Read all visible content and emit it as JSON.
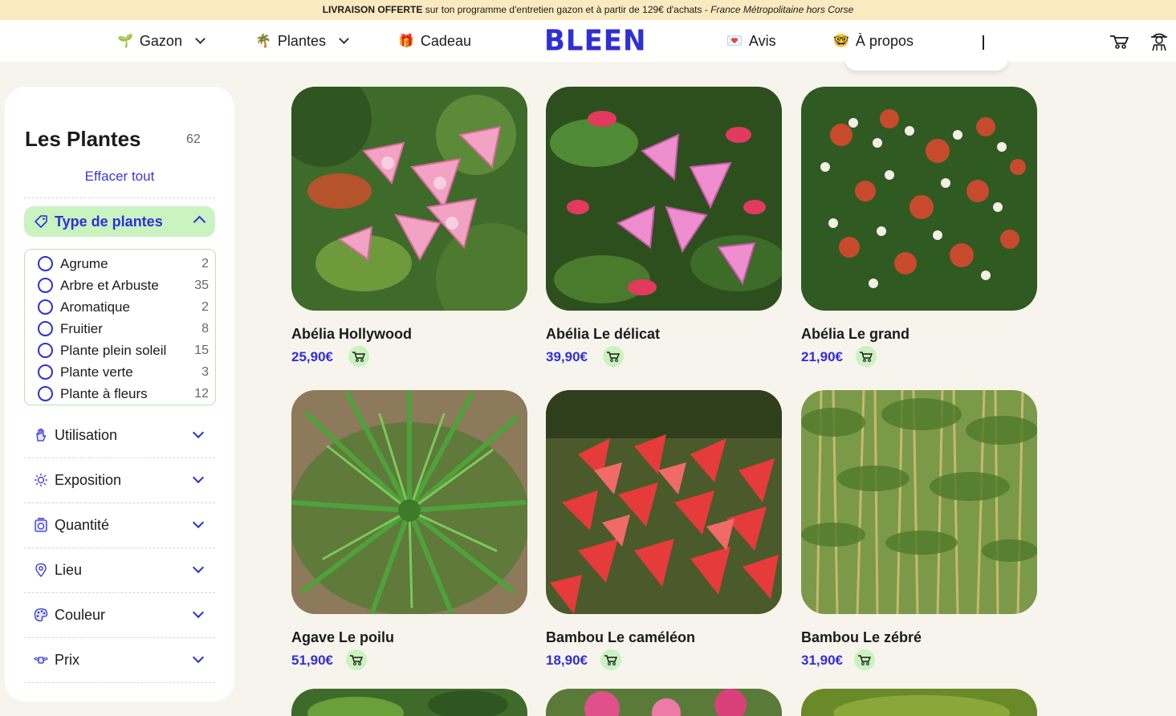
{
  "banner": {
    "bold": "LIVRAISON OFFERTE",
    "text": " sur ton programme d'entretien gazon et à partir de 129€ d'achats - ",
    "italic": "France Métropolitaine hors Corse"
  },
  "nav": {
    "items": [
      {
        "label": "Gazon",
        "emoji": "🌱"
      },
      {
        "label": "Plantes",
        "emoji": "🌴"
      },
      {
        "label": "Cadeau",
        "emoji": "🎁"
      },
      {
        "label": "Avis",
        "emoji": "💌"
      },
      {
        "label": "À propos",
        "emoji": "🤓"
      }
    ],
    "logo": "BLEEN",
    "icons": [
      "wheelbarrow-cart-icon",
      "user-gardener-icon"
    ]
  },
  "sidebar": {
    "title": "Les Plantes",
    "count": "62",
    "clear": "Effacer tout",
    "type_filter": {
      "label": "Type de plantes",
      "options": [
        {
          "label": "Agrume",
          "count": "2"
        },
        {
          "label": "Arbre et Arbuste",
          "count": "35"
        },
        {
          "label": "Aromatique",
          "count": "2"
        },
        {
          "label": "Fruitier",
          "count": "8"
        },
        {
          "label": "Plante plein soleil",
          "count": "15"
        },
        {
          "label": "Plante verte",
          "count": "3"
        },
        {
          "label": "Plante à fleurs",
          "count": "12"
        }
      ]
    },
    "facets": [
      {
        "label": "Utilisation",
        "icon": "hand-icon"
      },
      {
        "label": "Exposition",
        "icon": "sun-icon"
      },
      {
        "label": "Quantité",
        "icon": "scale-icon"
      },
      {
        "label": "Lieu",
        "icon": "location-pin-icon"
      },
      {
        "label": "Couleur",
        "icon": "palette-icon"
      },
      {
        "label": "Prix",
        "icon": "money-wings-icon"
      }
    ]
  },
  "products": [
    {
      "name": "Abélia Hollywood",
      "price": "25,90€"
    },
    {
      "name": "Abélia Le délicat",
      "price": "39,90€"
    },
    {
      "name": "Abélia Le grand",
      "price": "21,90€"
    },
    {
      "name": "Agave Le poilu",
      "price": "51,90€"
    },
    {
      "name": "Bambou Le caméléon",
      "price": "18,90€"
    },
    {
      "name": "Bambou Le zébré",
      "price": "31,90€"
    }
  ],
  "colors": {
    "accent": "#2f2fd6",
    "green_highlight": "#c9f3bf",
    "banner": "#fbe9c0",
    "background": "#f7f4ee"
  }
}
